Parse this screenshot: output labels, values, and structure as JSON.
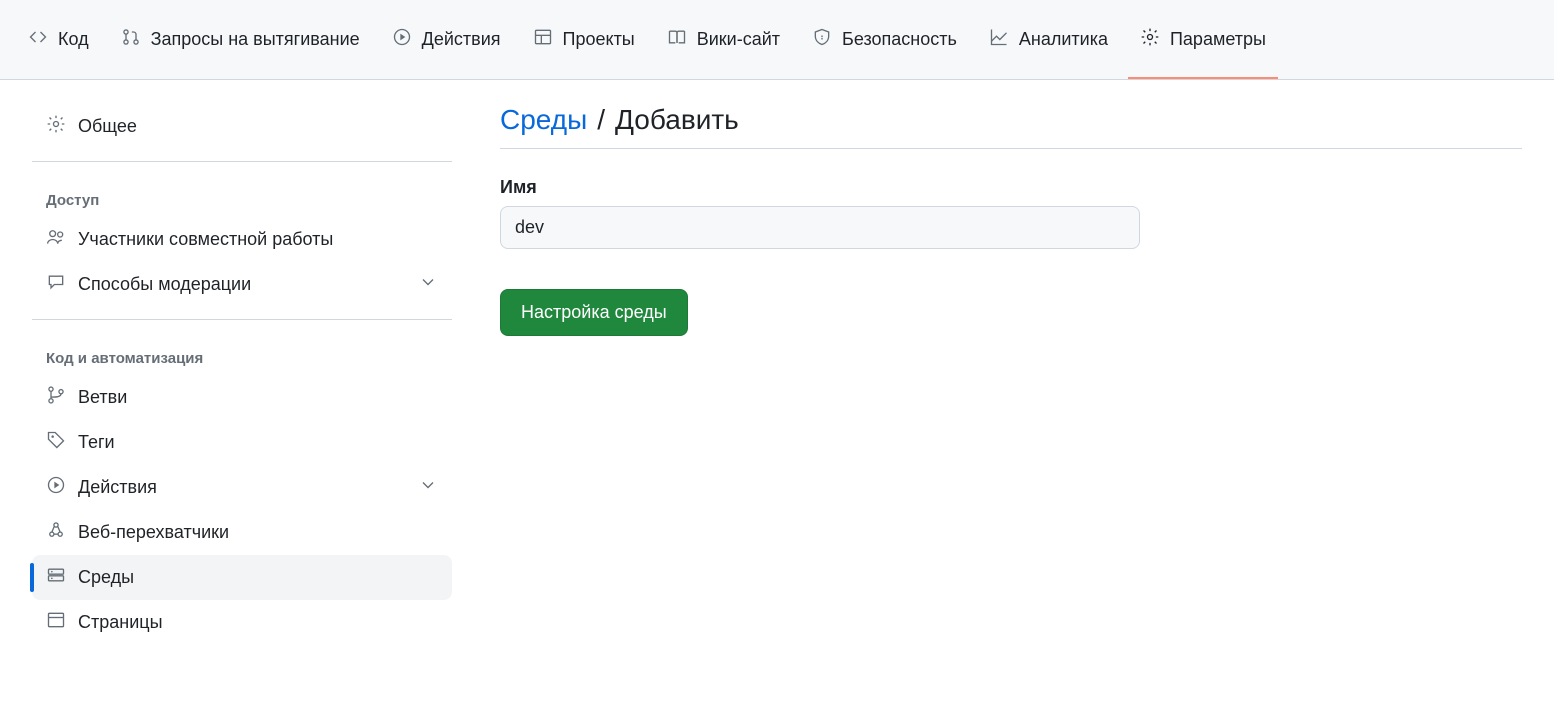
{
  "topnav": {
    "tabs": [
      {
        "label": "Код",
        "icon": "code"
      },
      {
        "label": "Запросы на вытягивание",
        "icon": "pull-request"
      },
      {
        "label": "Действия",
        "icon": "play"
      },
      {
        "label": "Проекты",
        "icon": "table"
      },
      {
        "label": "Вики-сайт",
        "icon": "book"
      },
      {
        "label": "Безопасность",
        "icon": "shield"
      },
      {
        "label": "Аналитика",
        "icon": "graph"
      },
      {
        "label": "Параметры",
        "icon": "gear"
      }
    ],
    "active_index": 7
  },
  "sidebar": {
    "general": {
      "label": "Общее"
    },
    "section_access": {
      "heading": "Доступ",
      "items": [
        {
          "label": "Участники совместной работы",
          "icon": "people"
        },
        {
          "label": "Способы модерации",
          "icon": "comment",
          "expandable": true
        }
      ]
    },
    "section_code": {
      "heading": "Код и автоматизация",
      "items": [
        {
          "label": "Ветви",
          "icon": "branch"
        },
        {
          "label": "Теги",
          "icon": "tag"
        },
        {
          "label": "Действия",
          "icon": "play",
          "expandable": true
        },
        {
          "label": "Веб-перехватчики",
          "icon": "webhook"
        },
        {
          "label": "Среды",
          "icon": "server",
          "selected": true
        },
        {
          "label": "Страницы",
          "icon": "browser"
        }
      ]
    }
  },
  "main": {
    "breadcrumb": {
      "link": "Среды",
      "separator": "/",
      "current": "Добавить"
    },
    "name_label": "Имя",
    "name_value": "dev",
    "submit_label": "Настройка среды"
  }
}
